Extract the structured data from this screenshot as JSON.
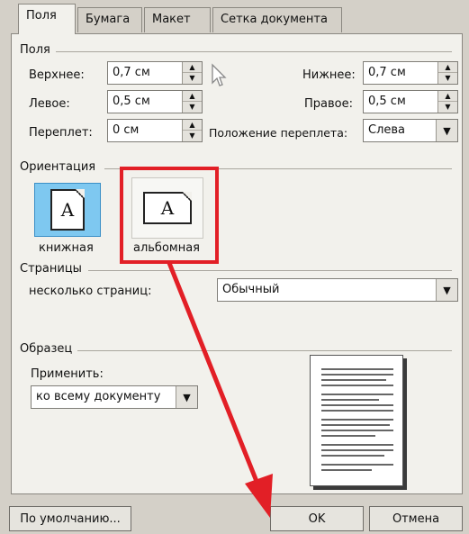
{
  "tabs": [
    {
      "label": "Поля"
    },
    {
      "label": "Бумага"
    },
    {
      "label": "Макет"
    },
    {
      "label": "Сетка документа"
    }
  ],
  "margins": {
    "section": "Поля",
    "top_label": "Верхнее:",
    "top_value": "0,7 см",
    "bottom_label": "Нижнее:",
    "bottom_value": "0,7 см",
    "left_label": "Левое:",
    "left_value": "0,5 см",
    "right_label": "Правое:",
    "right_value": "0,5 см",
    "gutter_label": "Переплет:",
    "gutter_value": "0 см",
    "gutter_pos_label": "Положение переплета:",
    "gutter_pos_value": "Слева"
  },
  "orientation": {
    "section": "Ориентация",
    "portrait_label": "книжная",
    "landscape_label": "альбомная",
    "icon_letter": "A",
    "selected": "portrait"
  },
  "pages": {
    "section": "Страницы",
    "multiple_label": "несколько страниц:",
    "multiple_value": "Обычный"
  },
  "sample": {
    "section": "Образец",
    "apply_label": "Применить:",
    "apply_value": "ко всему документу"
  },
  "buttons": {
    "default": "По умолчанию...",
    "ok": "OK",
    "cancel": "Отмена"
  },
  "colors": {
    "annotation_red": "#e21f26",
    "selected_blue": "#7ec8f0"
  }
}
